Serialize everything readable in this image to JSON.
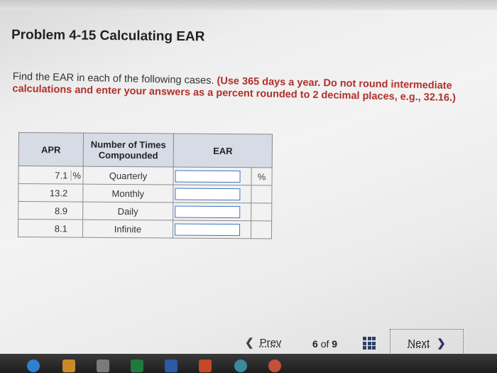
{
  "problem": {
    "title": "Problem 4-15 Calculating EAR",
    "instruction_plain": "Find the EAR in each of the following cases. ",
    "instruction_emphasis": "(Use 365 days a year. Do not round intermediate calculations and enter your answers as a percent rounded to 2 decimal places, e.g., 32.16.)"
  },
  "table": {
    "headers": {
      "apr": "APR",
      "compounding": "Number of Times Compounded",
      "ear": "EAR"
    },
    "rows": [
      {
        "apr": "7.1",
        "apr_unit": "%",
        "compounding": "Quarterly",
        "ear_value": "",
        "ear_unit": "%"
      },
      {
        "apr": "13.2",
        "apr_unit": "",
        "compounding": "Monthly",
        "ear_value": "",
        "ear_unit": ""
      },
      {
        "apr": "8.9",
        "apr_unit": "",
        "compounding": "Daily",
        "ear_value": "",
        "ear_unit": ""
      },
      {
        "apr": "8.1",
        "apr_unit": "",
        "compounding": "Infinite",
        "ear_value": "",
        "ear_unit": ""
      }
    ]
  },
  "nav": {
    "prev_label": "Prev",
    "page_current": "6",
    "page_of": "of",
    "page_total": "9",
    "next_label": "Next"
  },
  "icons": {
    "prev": "chevron-left-icon",
    "next": "chevron-right-icon",
    "overview": "grid-icon"
  },
  "colors": {
    "emphasis": "#b0302a",
    "input_border": "#3b74c7",
    "header_bg": "#d6dbe6"
  }
}
